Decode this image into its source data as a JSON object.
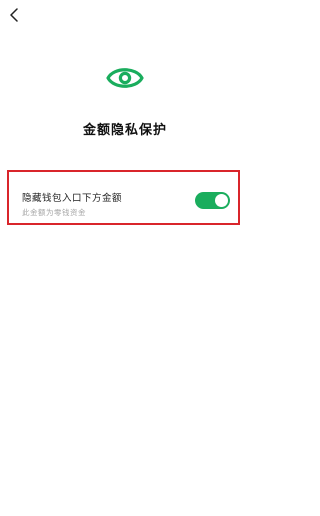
{
  "header": {
    "back_icon": "chevron-left-icon"
  },
  "hero": {
    "icon": "eye-icon",
    "accent_color": "#1aad5d",
    "title": "金额隐私保护"
  },
  "setting": {
    "title": "隐藏钱包入口下方金额",
    "description": "此金额为零钱资金",
    "toggle_on": true,
    "highlight_color": "#d9252b"
  }
}
